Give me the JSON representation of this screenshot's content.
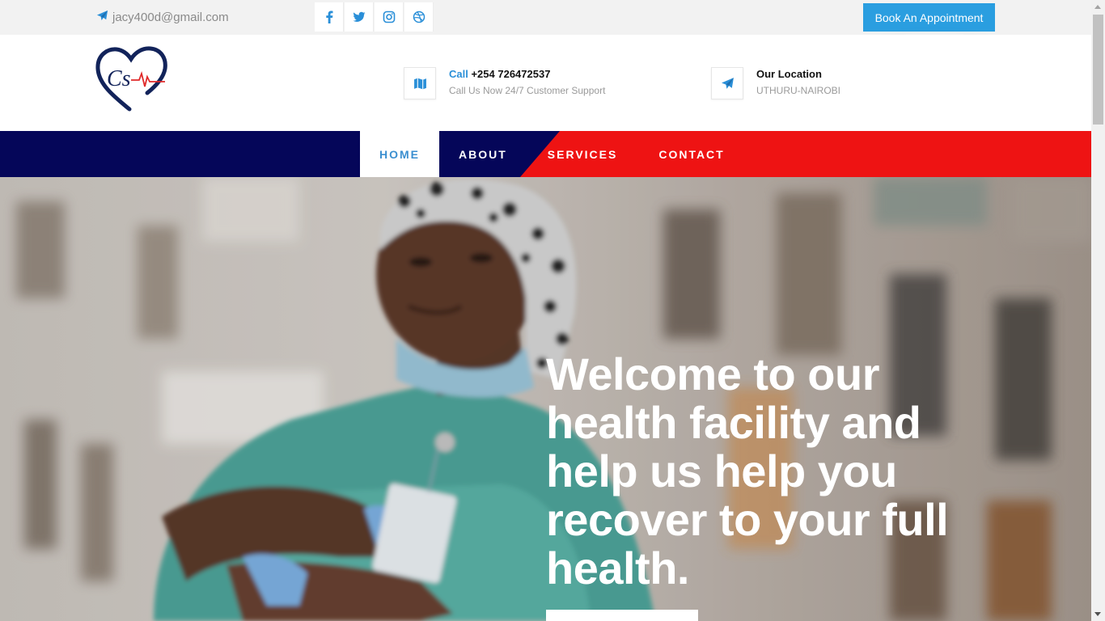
{
  "topbar": {
    "email": "jacy400d@gmail.com",
    "email_icon": "paper-plane-icon",
    "socials": [
      "facebook-icon",
      "twitter-icon",
      "instagram-icon",
      "dribbble-icon"
    ],
    "book_label": "Book An Appointment"
  },
  "header": {
    "logo_text": "Cs",
    "call": {
      "icon": "map-icon",
      "label": "Call",
      "number": "+254 726472537",
      "subtitle": "Call Us Now 24/7 Customer Support"
    },
    "location": {
      "icon": "paper-plane-icon",
      "title": "Our Location",
      "subtitle": "UTHURU-NAIROBI"
    }
  },
  "nav": {
    "items": [
      "HOME",
      "ABOUT",
      "SERVICES",
      "CONTACT"
    ],
    "active": "HOME"
  },
  "hero": {
    "heading": "Welcome to our health facility and help us help you recover to your full health."
  },
  "colors": {
    "accent": "#2a9ee0",
    "nav_navy": "#050659",
    "nav_red": "#ee1313"
  }
}
